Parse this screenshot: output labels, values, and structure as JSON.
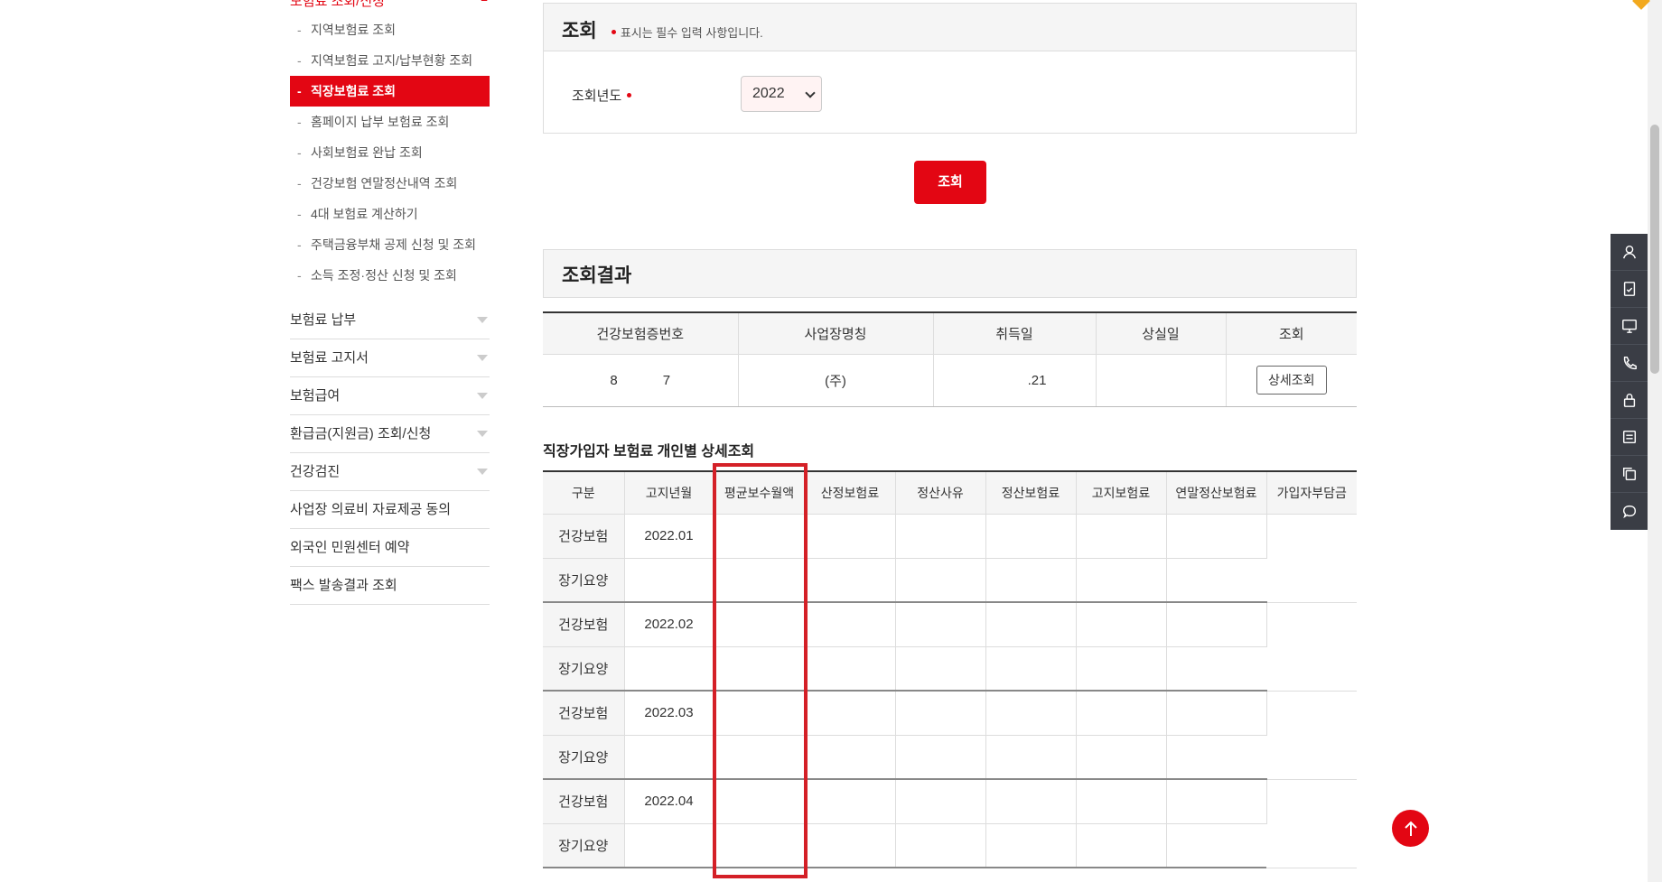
{
  "sidebar": {
    "section_title": "보험료 조회/신청",
    "sub_items": [
      {
        "label": "지역보험료 조회"
      },
      {
        "label": "지역보험료 고지/납부현황 조회"
      },
      {
        "label": "직장보험료 조회",
        "active": true
      },
      {
        "label": "홈페이지 납부 보험료 조회"
      },
      {
        "label": "사회보험료 완납 조회"
      },
      {
        "label": "건강보험 연말정산내역 조회"
      },
      {
        "label": "4대 보험료 계산하기"
      },
      {
        "label": "주택금융부채 공제 신청 및 조회"
      },
      {
        "label": "소득 조정·정산 신청 및 조회"
      }
    ],
    "main_items": [
      {
        "label": "보험료 납부",
        "expandable": true
      },
      {
        "label": "보험료 고지서",
        "expandable": true
      },
      {
        "label": "보험급여",
        "expandable": true
      },
      {
        "label": "환급금(지원금) 조회/신청",
        "expandable": true
      },
      {
        "label": "건강검진",
        "expandable": true
      },
      {
        "label": "사업장 의료비 자료제공 동의",
        "expandable": false
      },
      {
        "label": "외국인 민원센터 예약",
        "expandable": false
      },
      {
        "label": "팩스 발송결과 조회",
        "expandable": false
      }
    ]
  },
  "search": {
    "title": "조회",
    "required_note": "표시는 필수 입력 사항입니다.",
    "year_label": "조회년도",
    "year_value": "2022",
    "query_button": "조회"
  },
  "result": {
    "title": "조회결과",
    "columns": [
      "건강보험증번호",
      "사업장명칭",
      "취득일",
      "상실일",
      "조회"
    ],
    "row": {
      "card_no": "8            7",
      "company": "(주)",
      "acquired": ".21",
      "lost": "",
      "button": "상세조회"
    }
  },
  "detail": {
    "title": "직장가입자 보험료 개인별 상세조회",
    "columns": [
      "구분",
      "고지년월",
      "평균보수월액",
      "산정보험료",
      "정산사유",
      "정산보험료",
      "고지보험료",
      "연말정산보험료",
      "가입자부담금"
    ],
    "rows": [
      {
        "type": "건강보험",
        "month": "2022.01"
      },
      {
        "type": "장기요양",
        "month": ""
      },
      {
        "type": "건강보험",
        "month": "2022.02"
      },
      {
        "type": "장기요양",
        "month": ""
      },
      {
        "type": "건강보험",
        "month": "2022.03"
      },
      {
        "type": "장기요양",
        "month": ""
      },
      {
        "type": "건강보험",
        "month": "2022.04"
      },
      {
        "type": "장기요양",
        "month": ""
      }
    ]
  },
  "quick_bar": [
    "person-icon",
    "document-check-icon",
    "monitor-icon",
    "phone-icon",
    "lock-icon",
    "list-icon",
    "copy-icon",
    "chat-icon"
  ],
  "colors": {
    "accent": "#e30613",
    "highlight": "#d42027",
    "quick_bar": "#3a3d45"
  }
}
